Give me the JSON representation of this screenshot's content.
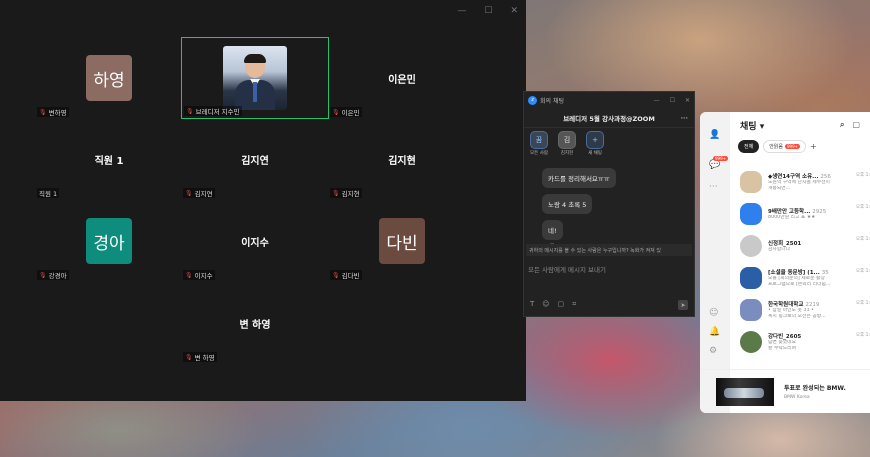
{
  "zoom": {
    "tiles": [
      {
        "id": "hayoung",
        "avatar_text": "하영",
        "avatar_color": "#8c6b62",
        "tag": "변하영"
      },
      {
        "id": "speaker",
        "tag": "브레디저 지수민"
      },
      {
        "id": "eunmin",
        "label": "이은민",
        "tag": "이은민"
      },
      {
        "id": "staff1",
        "label": "직원 1",
        "tag": "직원 1"
      },
      {
        "id": "jiyeon",
        "label": "김지연",
        "tag": "김지연"
      },
      {
        "id": "jihyun",
        "label": "김지현",
        "tag": "김지현"
      },
      {
        "id": "kyunga",
        "avatar_text": "경아",
        "avatar_color": "#0e8c7d",
        "tag": "강경아"
      },
      {
        "id": "jisu",
        "label": "이지수",
        "tag": "이지수"
      },
      {
        "id": "dabin",
        "avatar_text": "다빈",
        "avatar_color": "#6b4a3f",
        "tag": "김다빈"
      },
      {
        "id": "byeon",
        "label": "변 하영",
        "tag": "변 하영"
      }
    ]
  },
  "chat": {
    "title": "회의 채팅",
    "room": "브레디저 5월 강사과정@ZOOM",
    "tabs": [
      {
        "icon": "꿈",
        "label": "모든 사람"
      },
      {
        "icon": "김",
        "label": "김지현"
      },
      {
        "icon": "+",
        "label": "새 채팅"
      }
    ],
    "messages": [
      "카드를 정리해서요ㅠㅠ",
      "노랑 4 초록 5",
      "네!"
    ],
    "notice": "귀하의 메시지를 볼 수 있는 사람은 누구입니까? 녹화가 켜져 있",
    "input_placeholder": "모든 사람에게 메시지 보내기"
  },
  "kakao": {
    "header": "채팅 ▾",
    "side_badge": "999+",
    "filters": {
      "all": "전체",
      "unread": "안읽음",
      "unread_count": "999+"
    },
    "chats": [
      {
        "name": "◆생연14구역 소유...",
        "members": "256",
        "preview1": "노원역 구역에 단지별 세부선이",
        "preview2": "개봉되면...",
        "time": "오후 1:",
        "avatar": "#d8c3a5"
      },
      {
        "name": "9배만안 고등학...",
        "members": "2925",
        "preview1": "8000만원 리고 표 ★★",
        "preview2": "",
        "time": "오후 1:",
        "avatar": "#2f80ed"
      },
      {
        "name": "신정희_2501",
        "members": "",
        "preview1": "감사합니다",
        "preview2": "",
        "time": "오후 1:",
        "avatar": "#c9c9c9"
      },
      {
        "name": "[소셜클 동문방] (1...",
        "members": "35",
        "preview1": "오늘 [회의문의] 새로운 활장",
        "preview2": "프로그램으로 [본외리 리더쉽...",
        "time": "오후 1:",
        "avatar": "#2a5fa8"
      },
      {
        "name": "한국학원대학교",
        "members": "2219",
        "preview1": "• 삼일 마인도 옷 33 •",
        "preview2": "혹시 핑크보의 오전은 공방...",
        "time": "오후 1:",
        "avatar": "#7b8cbf"
      },
      {
        "name": "강다빈_2605",
        "members": "",
        "preview1": "답변 늦었네요",
        "preview2": "잘 부탁드리며",
        "time": "오후 1:",
        "avatar": "#5a7a4a"
      }
    ],
    "ad": {
      "title": "투표로 완성되는 BMW.",
      "sub": "BMW Korea"
    }
  }
}
